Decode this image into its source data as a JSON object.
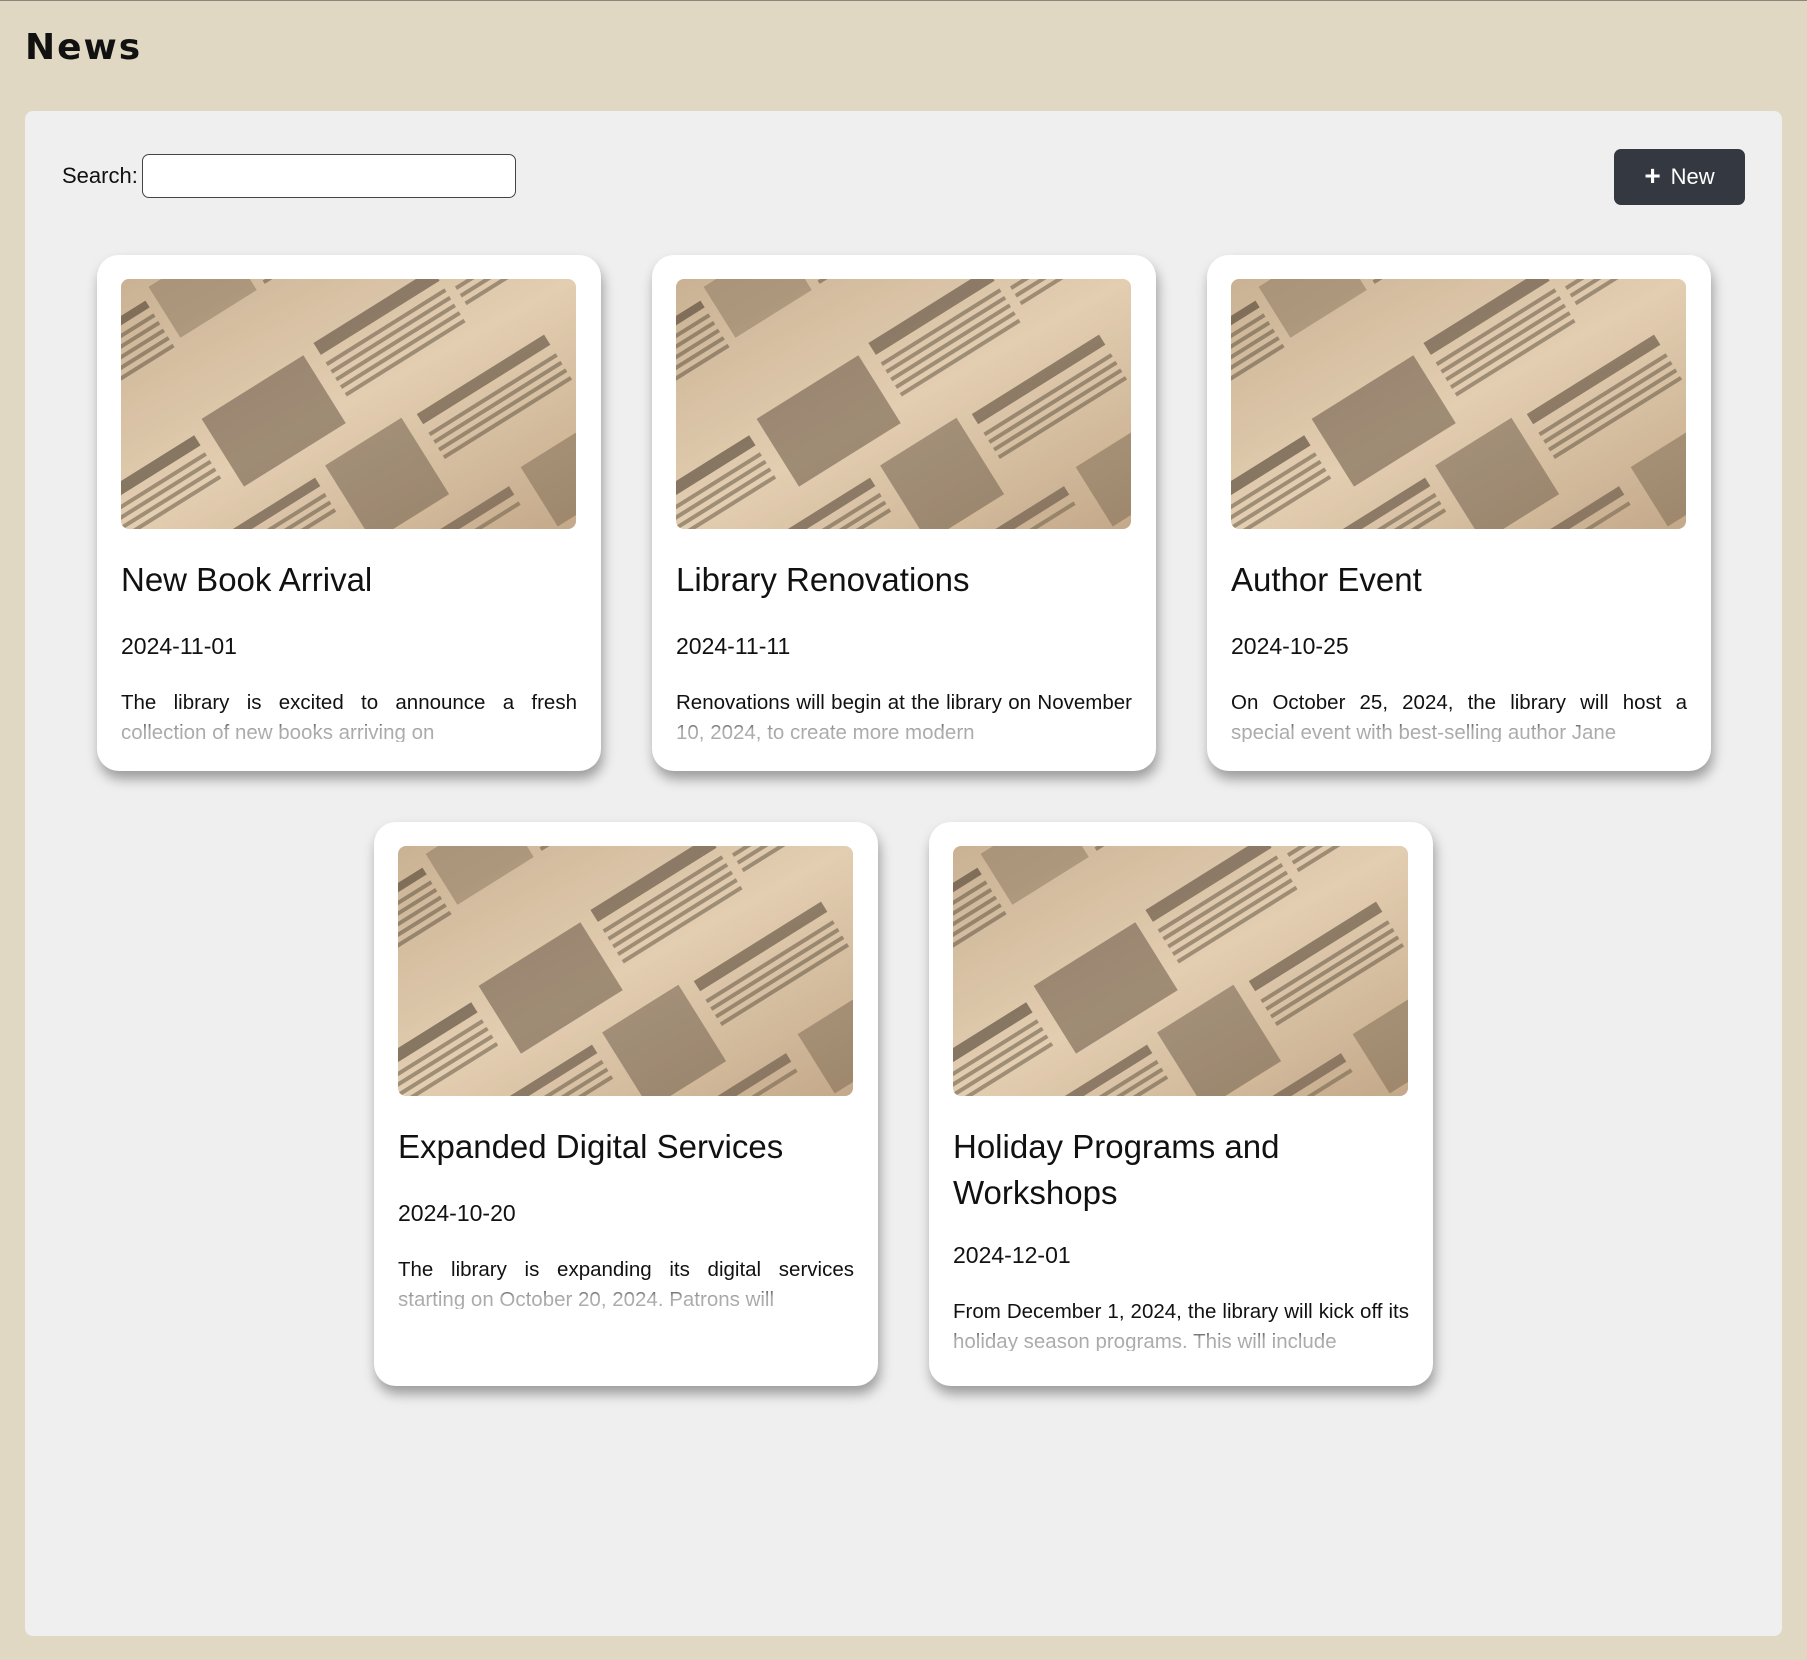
{
  "header": {
    "title": "News"
  },
  "toolbar": {
    "search_label": "Search:",
    "search_value": "",
    "search_placeholder": "",
    "new_label": "New",
    "new_icon": "plus-icon"
  },
  "colors": {
    "page_background": "#e0d8c2",
    "panel_background": "#efefef",
    "button_background": "#343840",
    "card_background": "#ffffff"
  },
  "news": [
    {
      "title": "New Book Arrival",
      "date": "2024-11-01",
      "summary": "The library is excited to announce a fresh collection of new books arriving on",
      "image": "vintage-newspaper-image"
    },
    {
      "title": "Library Renovations",
      "date": "2024-11-11",
      "summary": "Renovations will begin at the library on November 10, 2024, to create more modern",
      "image": "vintage-newspaper-image"
    },
    {
      "title": "Author Event",
      "date": "2024-10-25",
      "summary": "On October 25, 2024, the library will host a special event with best-selling author Jane",
      "image": "vintage-newspaper-image"
    },
    {
      "title": "Expanded Digital Services",
      "date": "2024-10-20",
      "summary": "The library is expanding its digital services starting on October 20, 2024. Patrons will",
      "image": "vintage-newspaper-image"
    },
    {
      "title": "Holiday Programs and Workshops",
      "date": "2024-12-01",
      "summary": "From December 1, 2024, the library will kick off its holiday season programs. This will include",
      "image": "vintage-newspaper-image"
    }
  ]
}
